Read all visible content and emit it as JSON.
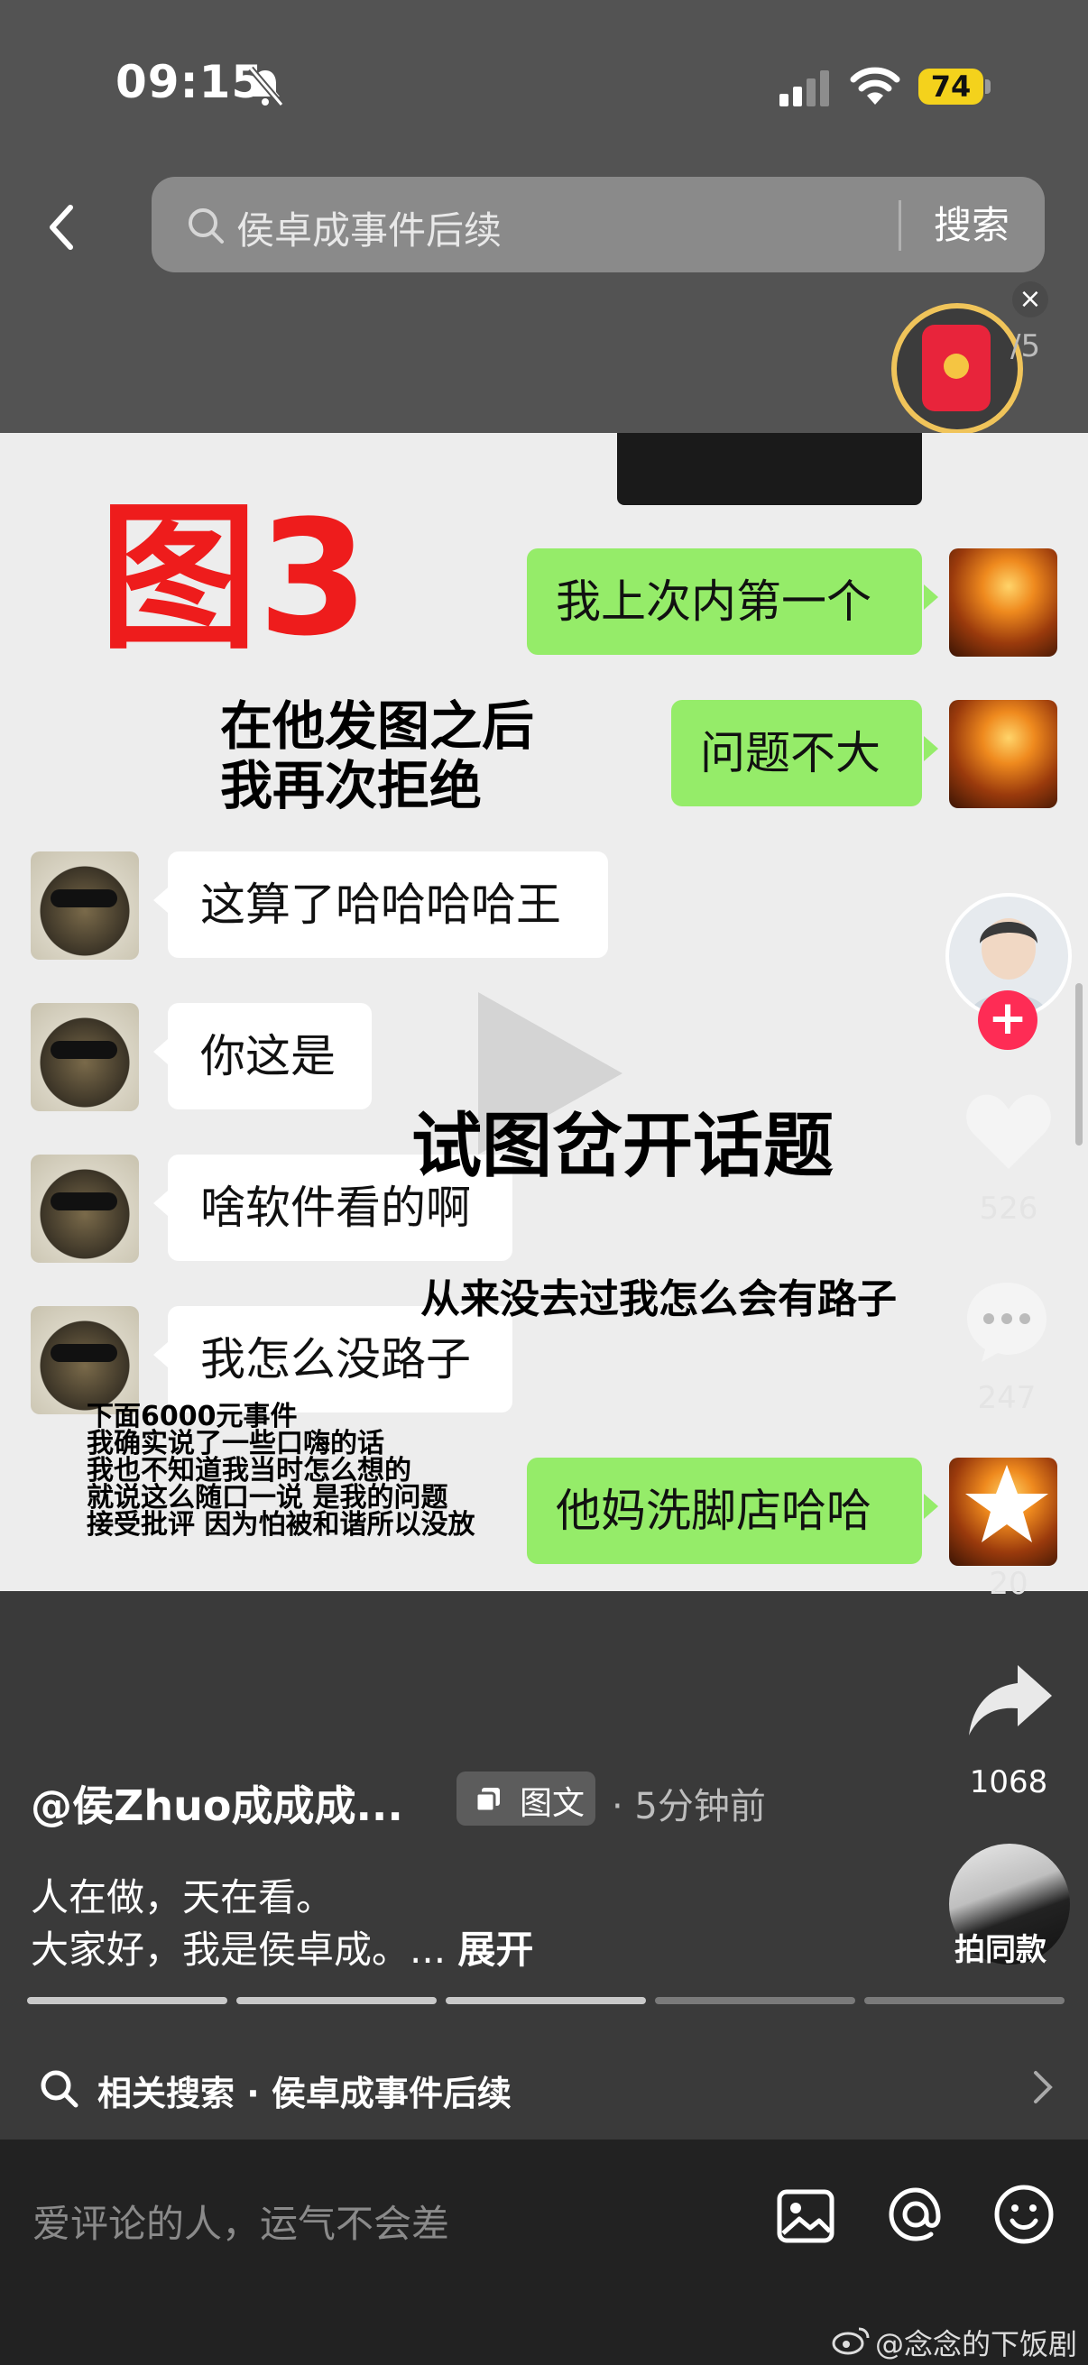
{
  "status_bar": {
    "time": "09:15",
    "battery": "74"
  },
  "search": {
    "query": "侯卓成事件后续",
    "button_label": "搜索"
  },
  "reward": {
    "counter": "/5",
    "close": "×"
  },
  "post_image": {
    "figure_label": "图3",
    "messages": [
      {
        "side": "right",
        "text": "我上次内第一个"
      },
      {
        "side": "right",
        "text": "问题不大"
      },
      {
        "side": "left",
        "text": "这算了哈哈哈哈王"
      },
      {
        "side": "left",
        "text": "你这是"
      },
      {
        "side": "left",
        "text": "啥软件看的啊"
      },
      {
        "side": "left",
        "text": "我怎么没路子"
      },
      {
        "side": "right",
        "text": "他妈洗脚店哈哈"
      }
    ],
    "annotations": {
      "after_image_1": "在他发图之后",
      "after_image_2": "我再次拒绝",
      "topic_change": "试图岔开话题",
      "never_been": "从来没去过我怎么会有路子",
      "note_lines": [
        "下面6000元事件",
        "我确实说了一些口嗨的话",
        "我也不知道我当时怎么想的",
        "就说这么随口一说 是我的问题",
        "接受批评 因为怕被和谐所以没放"
      ]
    }
  },
  "actions": {
    "likes": "526",
    "comments": "247",
    "favorites": "20",
    "shares": "1068"
  },
  "post_info": {
    "author": "@侯Zhuo成成成...",
    "type_label": "图文",
    "time": "· 5分钟前",
    "desc_line1": "人在做，天在看。",
    "desc_line2": "大家好，我是侯卓成。...",
    "expand": "展开",
    "same_style": "拍同款",
    "progress": {
      "total": 5,
      "completed": 3
    }
  },
  "related": {
    "text": "相关搜索 · 侯卓成事件后续"
  },
  "comment_bar": {
    "placeholder": "爱评论的人，运气不会差"
  },
  "watermark": "@念念的下饭剧"
}
